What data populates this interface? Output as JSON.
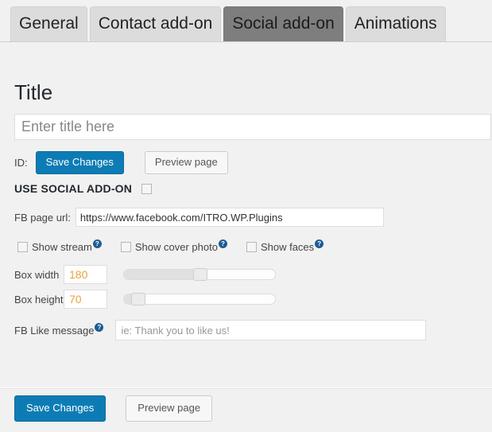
{
  "tabs": [
    {
      "label": "General",
      "active": false
    },
    {
      "label": "Contact add-on",
      "active": false
    },
    {
      "label": "Social add-on",
      "active": true
    },
    {
      "label": "Animations",
      "active": false
    }
  ],
  "page": {
    "heading": "Title",
    "title_input_value": "",
    "title_input_placeholder": "Enter title here"
  },
  "id_row": {
    "id_label": "ID:",
    "save_label": "Save Changes",
    "preview_label": "Preview page"
  },
  "use_addon": {
    "label": "USE SOCIAL ADD-ON",
    "checked": false
  },
  "fb_url": {
    "label": "FB page url:",
    "value": "https://www.facebook.com/ITRO.WP.Plugins",
    "placeholder": ""
  },
  "options": [
    {
      "label": "Show stream",
      "checked": false,
      "help": "?"
    },
    {
      "label": "Show cover photo",
      "checked": false,
      "help": "?"
    },
    {
      "label": "Show faces",
      "checked": false,
      "help": "?"
    }
  ],
  "box_width": {
    "label": "Box width",
    "value": "180",
    "slider_percent": 48
  },
  "box_height": {
    "label": "Box height",
    "value": "70",
    "slider_percent": 7
  },
  "fb_like": {
    "label": "FB Like message",
    "help": "?",
    "value": "",
    "placeholder": "ie: Thank you to like us!"
  },
  "footer": {
    "save_label": "Save Changes",
    "preview_label": "Preview page"
  },
  "colors": {
    "accent_blue": "#0d7cb5",
    "active_tab": "#7e7e7e",
    "tab_bg": "#dcdcdc",
    "page_bg": "#f1f1f1",
    "value_orange": "#e8a33d",
    "help_icon_blue": "#1e5c94"
  }
}
